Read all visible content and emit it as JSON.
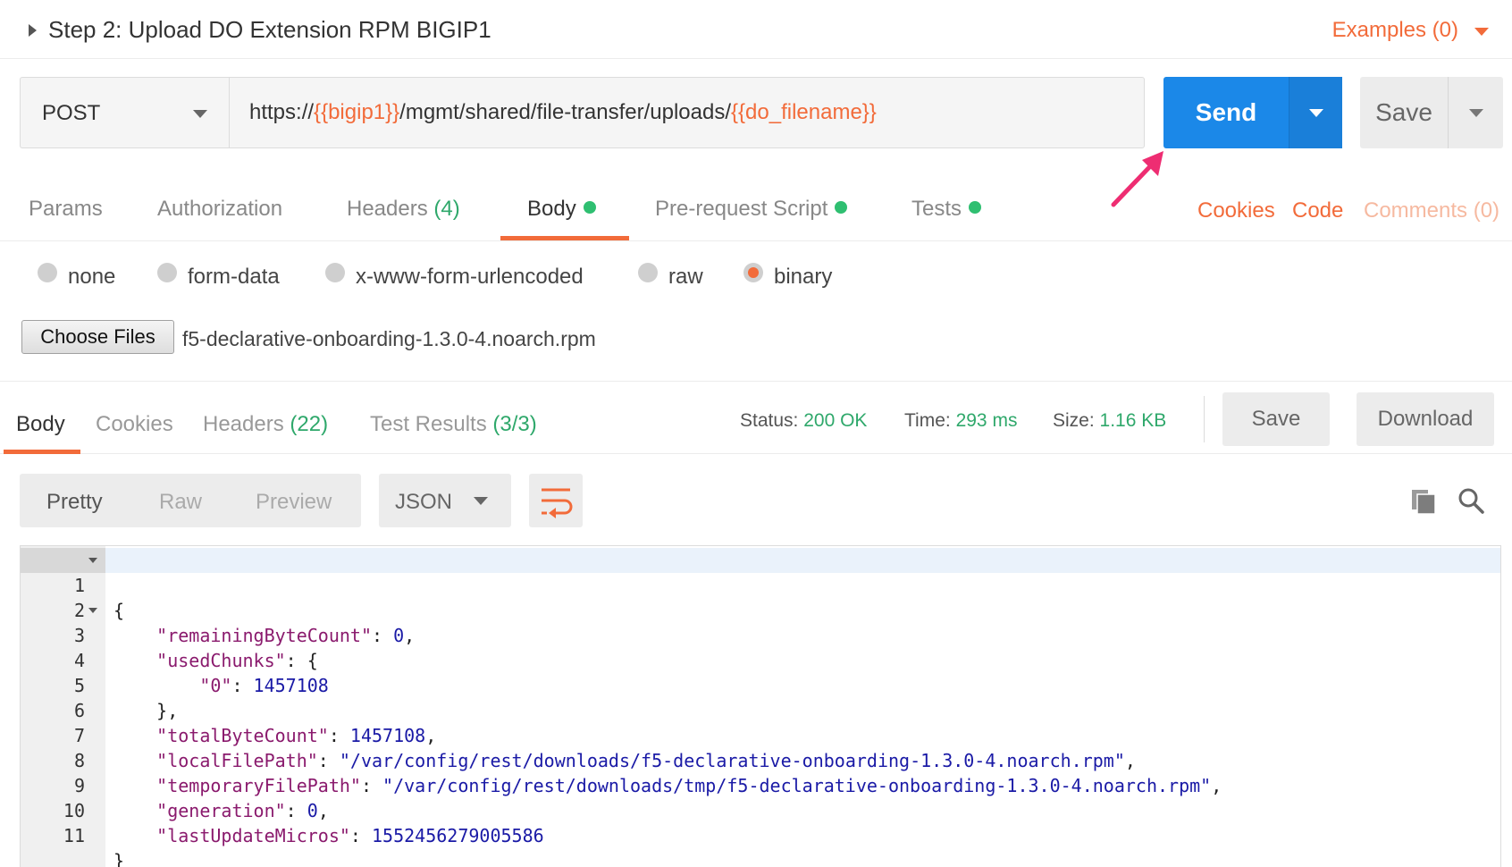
{
  "request": {
    "title": "Step 2: Upload DO Extension RPM BIGIP1",
    "examples_label": "Examples (0)",
    "method": "POST",
    "url": {
      "prefix": "https://",
      "var1": "{{bigip1}}",
      "middle": "/mgmt/shared/file-transfer/uploads/",
      "var2": "{{do_filename}}"
    },
    "send_label": "Send",
    "save_label": "Save"
  },
  "request_tabs": {
    "params": "Params",
    "authorization": "Authorization",
    "headers": "Headers",
    "headers_count": "(4)",
    "body": "Body",
    "prerequest": "Pre-request Script",
    "tests": "Tests",
    "cookies": "Cookies",
    "code": "Code",
    "comments": "Comments (0)"
  },
  "body_types": {
    "none": "none",
    "form_data": "form-data",
    "urlencoded": "x-www-form-urlencoded",
    "raw": "raw",
    "binary": "binary",
    "selected": "binary"
  },
  "file": {
    "choose_label": "Choose Files",
    "name": "f5-declarative-onboarding-1.3.0-4.noarch.rpm"
  },
  "response_tabs": {
    "body": "Body",
    "cookies": "Cookies",
    "headers": "Headers",
    "headers_count": "(22)",
    "test_results": "Test Results",
    "test_results_count": "(3/3)"
  },
  "response_meta": {
    "status_label": "Status:",
    "status_value": "200 OK",
    "time_label": "Time:",
    "time_value": "293 ms",
    "size_label": "Size:",
    "size_value": "1.16 KB",
    "save_label": "Save",
    "download_label": "Download"
  },
  "viewer": {
    "pretty": "Pretty",
    "raw": "Raw",
    "preview": "Preview",
    "format": "JSON"
  },
  "code_lines": [
    {
      "n": "1",
      "text": "{"
    },
    {
      "n": "2",
      "key": "\"remainingByteCount\"",
      "val": "0",
      "tail": ","
    },
    {
      "n": "3",
      "key": "\"usedChunks\"",
      "val": "{",
      "tail": ""
    },
    {
      "n": "4",
      "key": "\"0\"",
      "val": "1457108",
      "tail": ""
    },
    {
      "n": "5",
      "text": "},"
    },
    {
      "n": "6",
      "key": "\"totalByteCount\"",
      "val": "1457108",
      "tail": ","
    },
    {
      "n": "7",
      "key": "\"localFilePath\"",
      "val": "\"/var/config/rest/downloads/f5-declarative-onboarding-1.3.0-4.noarch.rpm\"",
      "tail": ","
    },
    {
      "n": "8",
      "key": "\"temporaryFilePath\"",
      "val": "\"/var/config/rest/downloads/tmp/f5-declarative-onboarding-1.3.0-4.noarch.rpm\"",
      "tail": ","
    },
    {
      "n": "9",
      "key": "\"generation\"",
      "val": "0",
      "tail": ","
    },
    {
      "n": "10",
      "key": "\"lastUpdateMicros\"",
      "val": "1552456279005586",
      "tail": ""
    },
    {
      "n": "11",
      "text": "}"
    }
  ],
  "colors": {
    "accent": "#f26b3a",
    "send": "#1b88e8",
    "success": "#2fa86b"
  }
}
